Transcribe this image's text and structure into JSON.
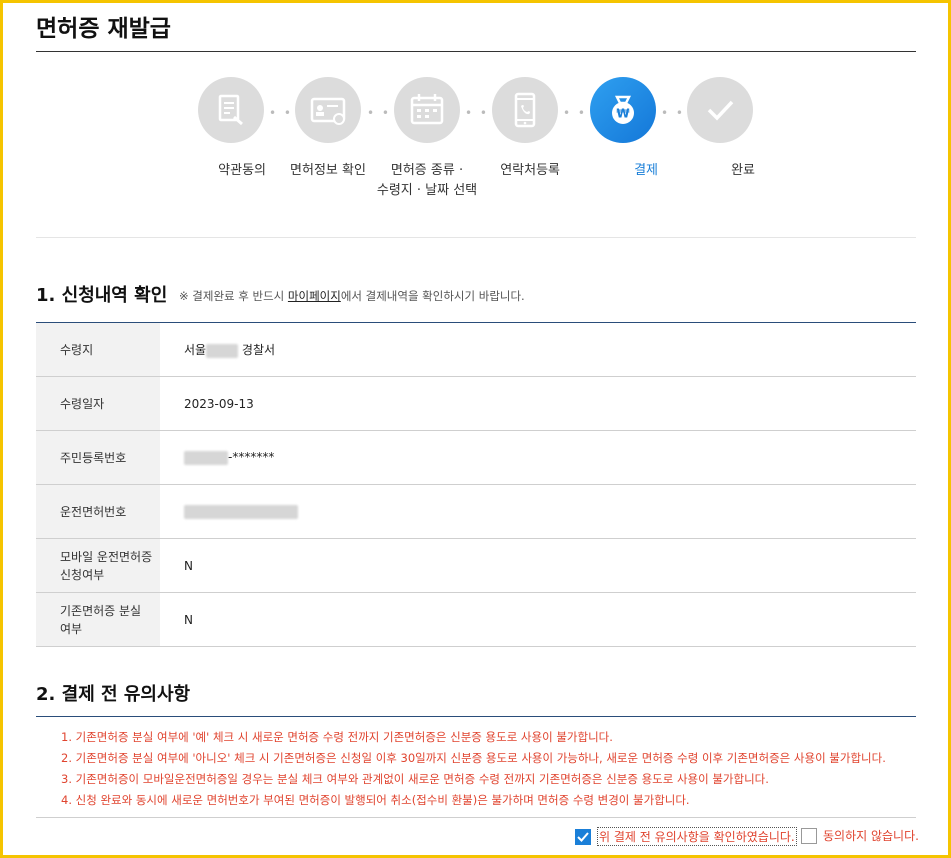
{
  "page": {
    "title": "면허증 재발급"
  },
  "steps": [
    {
      "label": "약관동의",
      "icon": "document-pen-icon",
      "active": false
    },
    {
      "label": "면허정보 확인",
      "icon": "id-card-icon",
      "active": false
    },
    {
      "label": "면허증 종류 ·",
      "label2": "수령지 · 날짜 선택",
      "icon": "calendar-icon",
      "active": false
    },
    {
      "label": "연락처등록",
      "icon": "phone-icon",
      "active": false
    },
    {
      "label": "결제",
      "icon": "won-bag-icon",
      "active": true
    },
    {
      "label": "완료",
      "icon": "check-icon",
      "active": false
    }
  ],
  "section1": {
    "title": "1. 신청내역 확인",
    "note_prefix": "※ 결제완료 후 반드시 ",
    "note_link": "마이페이지",
    "note_suffix": "에서 결제내역을 확인하시기 바랍니다."
  },
  "info_rows": [
    {
      "label": "수령지",
      "value_prefix": "서울",
      "value_suffix": " 경찰서"
    },
    {
      "label": "수령일자",
      "value": "2023-09-13"
    },
    {
      "label": "주민등록번호",
      "value_suffix": "-*******"
    },
    {
      "label": "운전면허번호",
      "value": ""
    },
    {
      "label": "모바일 운전면허증",
      "label2": "신청여부",
      "value": "N"
    },
    {
      "label": "기존면허증 분실",
      "label2": "여부",
      "value": "N"
    }
  ],
  "section2": {
    "title": "2. 결제 전 유의사항",
    "notices": [
      "1. 기존면허증 분실 여부에 '예' 체크 시 새로운 면허증 수령 전까지 기존면허증은 신분증 용도로 사용이 불가합니다.",
      "2. 기존면허증 분실 여부에 '아니오' 체크 시 기존면허증은 신청일 이후 30일까지 신분증 용도로 사용이 가능하나, 새로운 면허증 수령 이후 기존면허증은 사용이 불가합니다.",
      "3. 기존면허증이 모바일운전면허증일 경우는 분실 체크 여부와 관계없이 새로운 면허증 수령 전까지 기존면허증은 신분증 용도로 사용이 불가합니다.",
      "4. 신청 완료와 동시에 새로운 면허번호가 부여된 면허증이 발행되어 취소(접수비 환불)은 불가하며 면허증 수령 변경이 불가합니다."
    ]
  },
  "agreement": {
    "agree_label": "위 결제 전 유의사항을 확인하였습니다.",
    "agree_checked": true,
    "disagree_label": "동의하지 않습니다.",
    "disagree_checked": false
  },
  "colors": {
    "accent": "#1a7fd8",
    "warning": "#e0442f",
    "border": "#f5c400"
  }
}
